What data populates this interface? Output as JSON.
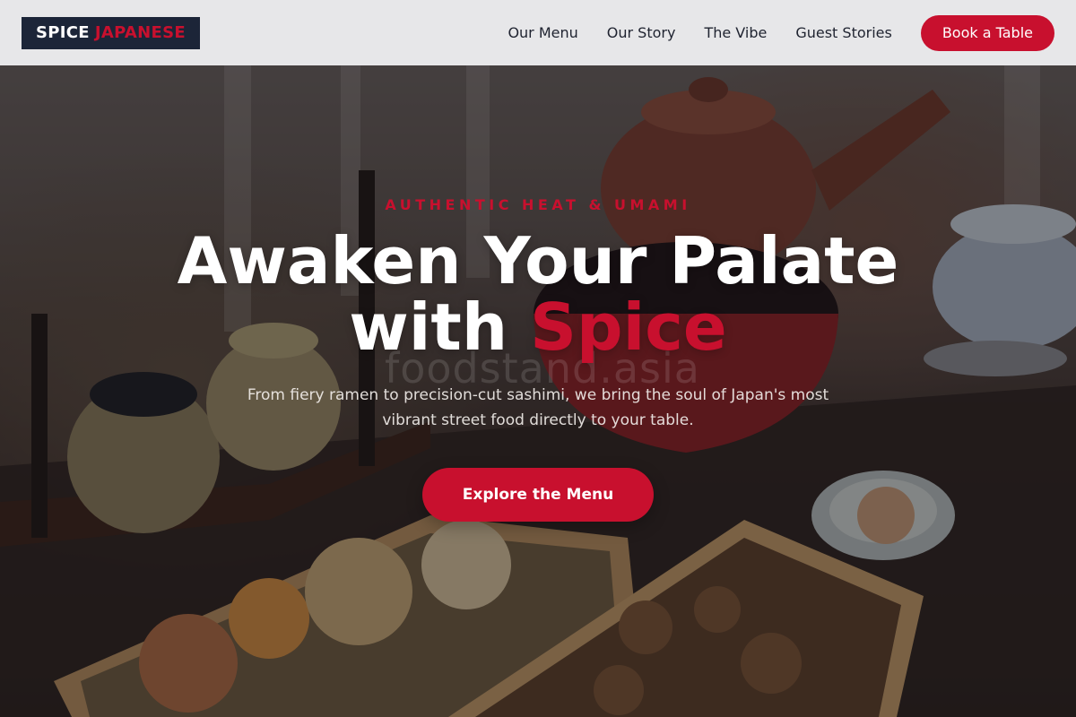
{
  "brand": {
    "part1": "SPICE",
    "part2": "JAPANESE"
  },
  "nav": {
    "links": [
      "Our Menu",
      "Our Story",
      "The Vibe",
      "Guest Stories"
    ],
    "cta": "Book a Table"
  },
  "hero": {
    "kicker": "AUTHENTIC HEAT & UMAMI",
    "headline_line1": "Awaken Your Palate",
    "headline_line2_prefix": "with",
    "headline_accent": "Spice",
    "subtitle": "From fiery ramen to precision-cut sashimi, we bring the soul of Japan's most vibrant street food directly to your table.",
    "cta": "Explore the Menu",
    "watermark": "foodstand.asia"
  },
  "colors": {
    "accent": "#c8102e",
    "logo_bg": "#1c2538",
    "nav_bg": "#ececee"
  }
}
